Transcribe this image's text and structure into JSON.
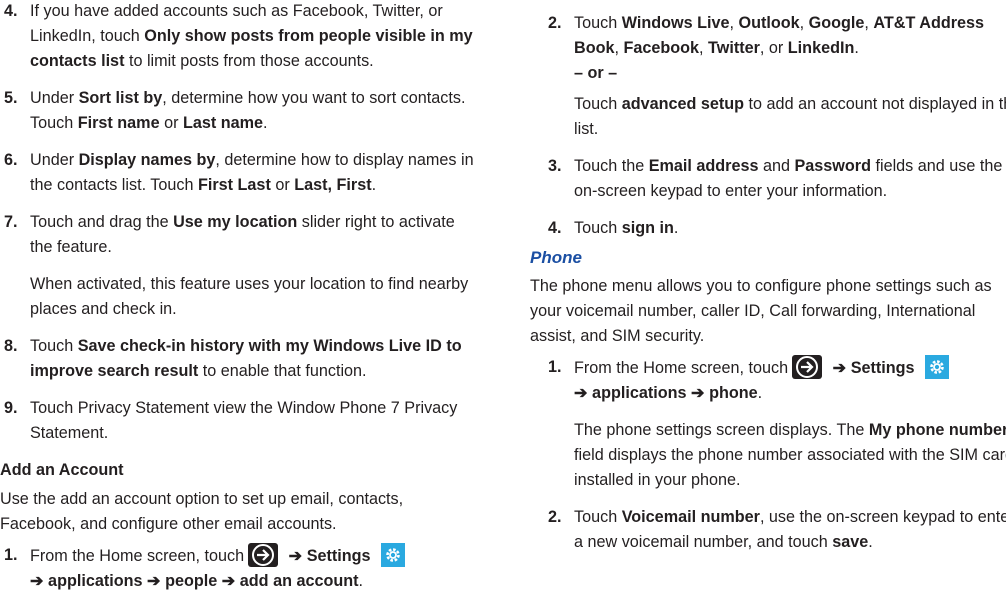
{
  "left": {
    "step4": {
      "num": "4.",
      "t1": "If you have added accounts such as Facebook, Twitter, or LinkedIn, touch ",
      "b1": "Only show posts from people visible in my contacts list",
      "t2": " to limit posts from those accounts."
    },
    "step5": {
      "num": "5.",
      "t1": "Under ",
      "b1": "Sort list by",
      "t2": ", determine how you want to sort contacts. Touch ",
      "b2": "First name",
      "t3": " or ",
      "b3": "Last name",
      "t4": "."
    },
    "step6": {
      "num": "6.",
      "t1": "Under ",
      "b1": "Display names by",
      "t2": ", determine how to display names in the contacts list. Touch ",
      "b2": "First Last",
      "t3": " or ",
      "b3": "Last, First",
      "t4": "."
    },
    "step7": {
      "num": "7.",
      "t1": "Touch and drag the ",
      "b1": "Use my location",
      "t2": " slider right to activate the feature.",
      "sub": "When activated, this feature uses your location to find nearby places and check in."
    },
    "step8": {
      "num": "8.",
      "t1": "Touch ",
      "b1": "Save check-in history with my Windows Live ID to improve search result",
      "t2": " to enable that function."
    },
    "step9": {
      "num": "9.",
      "t1": "Touch Privacy Statement view the Window Phone 7 Privacy Statement."
    },
    "heading": "Add an Account",
    "para": "Use the add an account option to set up email, contacts, Facebook, and configure other email accounts.",
    "step1": {
      "num": "1.",
      "t1": "From the Home screen, touch",
      "arrow1": " ➔ ",
      "b1": "Settings",
      "line2": "➔ applications ➔ people ➔ add an account",
      "t2": "."
    }
  },
  "right": {
    "step2": {
      "num": "2.",
      "t1": "Touch ",
      "b1": "Windows Live",
      "c1": ", ",
      "b2": "Outlook",
      "c2": ", ",
      "b3": "Google",
      "c3": ", ",
      "b4": "AT&T Address Book",
      "c4": ", ",
      "b5": "Facebook",
      "c5": ", ",
      "b6": "Twitter",
      "c6": ", or ",
      "b7": "LinkedIn",
      "c7": ".",
      "or": "– or –",
      "sub_t1": "Touch ",
      "sub_b1": "advanced setup",
      "sub_t2": " to add an account not displayed in the list."
    },
    "step3": {
      "num": "3.",
      "t1": "Touch the ",
      "b1": "Email address",
      "t2": " and ",
      "b2": "Password",
      "t3": " fields and use the on-screen keypad to enter your information."
    },
    "step4": {
      "num": "4.",
      "t1": "Touch ",
      "b1": "sign in",
      "t2": "."
    },
    "heading": "Phone",
    "para": "The phone menu allows you to configure phone settings such as your voicemail number, caller ID, Call forwarding, International assist, and SIM security.",
    "step1": {
      "num": "1.",
      "t1": "From the Home screen, touch",
      "arrow1": " ➔ ",
      "b1": "Settings",
      "line2": "➔ applications ➔ phone",
      "t2": ".",
      "sub_t1": "The phone settings screen displays. The ",
      "sub_b1": "My phone number",
      "sub_t2": " field displays the phone number associated with the SIM card installed in your phone."
    },
    "step2b": {
      "num": "2.",
      "t1": "Touch ",
      "b1": "Voicemail number",
      "t2": ", use the on-screen keypad to enter a new voicemail number, and touch ",
      "b2": "save",
      "t3": "."
    }
  }
}
